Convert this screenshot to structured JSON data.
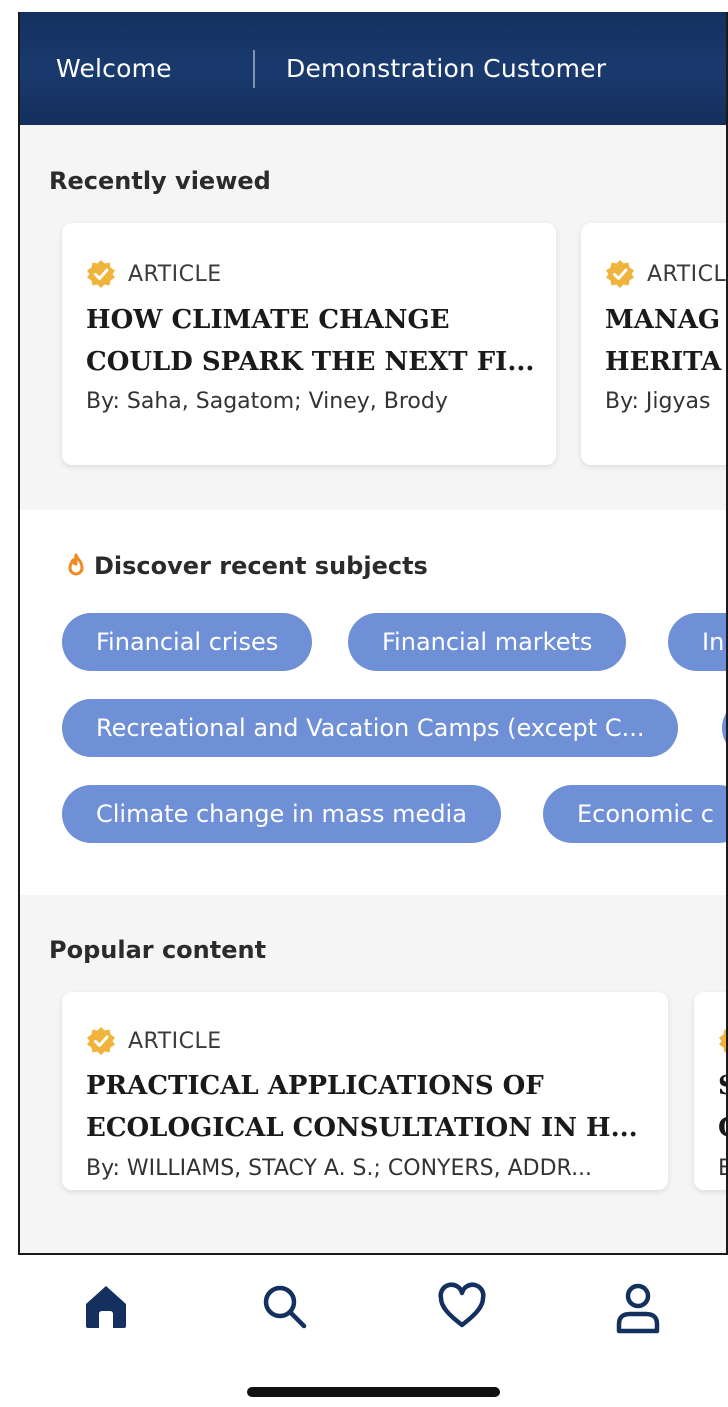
{
  "header": {
    "welcome": "Welcome",
    "customer": "Demonstration Customer"
  },
  "recently_viewed": {
    "title": "Recently viewed",
    "cards": [
      {
        "type": "ARTICLE",
        "title_line1": "HOW CLIMATE CHANGE",
        "title_line2": "COULD SPARK THE NEXT FI...",
        "authors": "By: Saha, Sagatom; Viney, Brody"
      },
      {
        "type": "ARTICL",
        "title_line1": "MANAG",
        "title_line2": "HERITA",
        "authors": "By: Jigyas"
      }
    ]
  },
  "discover": {
    "title": "Discover recent subjects",
    "chips": [
      "Financial crises",
      "Financial markets",
      "In",
      "Recreational and Vacation Camps (except C...",
      "Climate change in mass media",
      "Economic c"
    ]
  },
  "popular": {
    "title": "Popular content",
    "cards": [
      {
        "type": "ARTICLE",
        "title_line1": "PRACTICAL APPLICATIONS OF",
        "title_line2": "ECOLOGICAL CONSULTATION IN H...",
        "authors": "By: WILLIAMS, STACY A. S.; CONYERS, ADDR..."
      },
      {
        "title_line1": "S",
        "title_line2": "C",
        "authors": "E"
      }
    ]
  },
  "colors": {
    "header_bg": "#1a3a6e",
    "chip_bg": "#6f8fd6",
    "badge": "#f0b43c",
    "flame": "#f08a24",
    "nav_icon": "#13305f"
  },
  "nav": {
    "items": [
      "home-icon",
      "search-icon",
      "heart-icon",
      "profile-icon"
    ]
  }
}
